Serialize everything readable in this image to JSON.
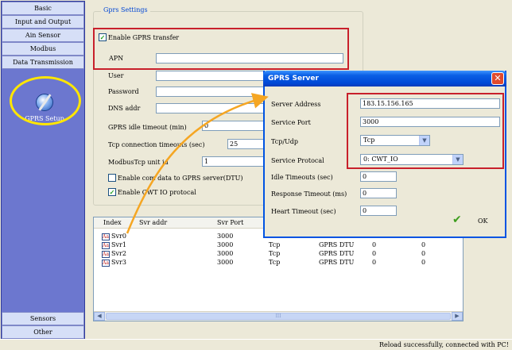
{
  "sidebar": {
    "tabs": [
      "Basic",
      "Input and Output",
      "Ain Sensor",
      "Modbus",
      "Data Transmission"
    ],
    "active_item": "GPRS Setup",
    "bottom_tabs": [
      "Sensors",
      "Other"
    ]
  },
  "gprs_settings": {
    "group_title": "Gprs Settings",
    "enable_gprs_label": "Enable GPRS transfer",
    "enable_gprs_checked": true,
    "apn_label": "APN",
    "apn_value": "",
    "user_label": "User",
    "user_value": "",
    "password_label": "Password",
    "password_value": "",
    "dns_label": "DNS addr",
    "dns_value": "",
    "idle_timeout_label": "GPRS idle timeout (min)",
    "idle_timeout_value": "0",
    "tcp_conn_timeout_label": "Tcp connection timeouts (sec)",
    "tcp_conn_timeout_value": "25",
    "modbus_unit_label": "ModbusTcp unit id",
    "modbus_unit_value": "1",
    "enable_com_label": "Enable com data to GPRS server(DTU)",
    "enable_com_checked": false,
    "enable_cwt_label": "Enable CWT IO protocal",
    "enable_cwt_checked": true
  },
  "server_list": {
    "columns": [
      "Index",
      "Svr addr",
      "Svr Port"
    ],
    "rows": [
      {
        "index": "Svr0",
        "port": "3000",
        "protocol": "",
        "type": "",
        "a": "",
        "b": ""
      },
      {
        "index": "Svr1",
        "port": "3000",
        "protocol": "Tcp",
        "type": "GPRS DTU",
        "a": "0",
        "b": "0"
      },
      {
        "index": "Svr2",
        "port": "3000",
        "protocol": "Tcp",
        "type": "GPRS DTU",
        "a": "0",
        "b": "0"
      },
      {
        "index": "Svr3",
        "port": "3000",
        "protocol": "Tcp",
        "type": "GPRS DTU",
        "a": "0",
        "b": "0"
      }
    ],
    "scroll_grip": "III"
  },
  "dialog": {
    "title": "GPRS Server",
    "close_glyph": "✕",
    "server_address_label": "Server Address",
    "server_address_value": "183.15.156.165",
    "service_port_label": "Service Port",
    "service_port_value": "3000",
    "tcp_udp_label": "Tcp/Udp",
    "tcp_udp_value": "Tcp",
    "service_protocol_label": "Service Protocal",
    "service_protocol_value": "0: CWT_IO",
    "idle_timeouts_label": "Idle Timeouts (sec)",
    "idle_timeouts_value": "0",
    "response_timeout_label": "Response Timeout (ms)",
    "response_timeout_value": "0",
    "heart_timeout_label": "Heart Timeout (sec)",
    "heart_timeout_value": "0",
    "ok_label": "OK"
  },
  "status": {
    "text": "Reload successfully, connected with PC!"
  },
  "colors": {
    "sidebar": "#6c77cf",
    "highlight_box": "#c8202b",
    "highlight_ellipse": "#ffe600",
    "arrow": "#f5a623",
    "titlebar": "#0047d6"
  }
}
